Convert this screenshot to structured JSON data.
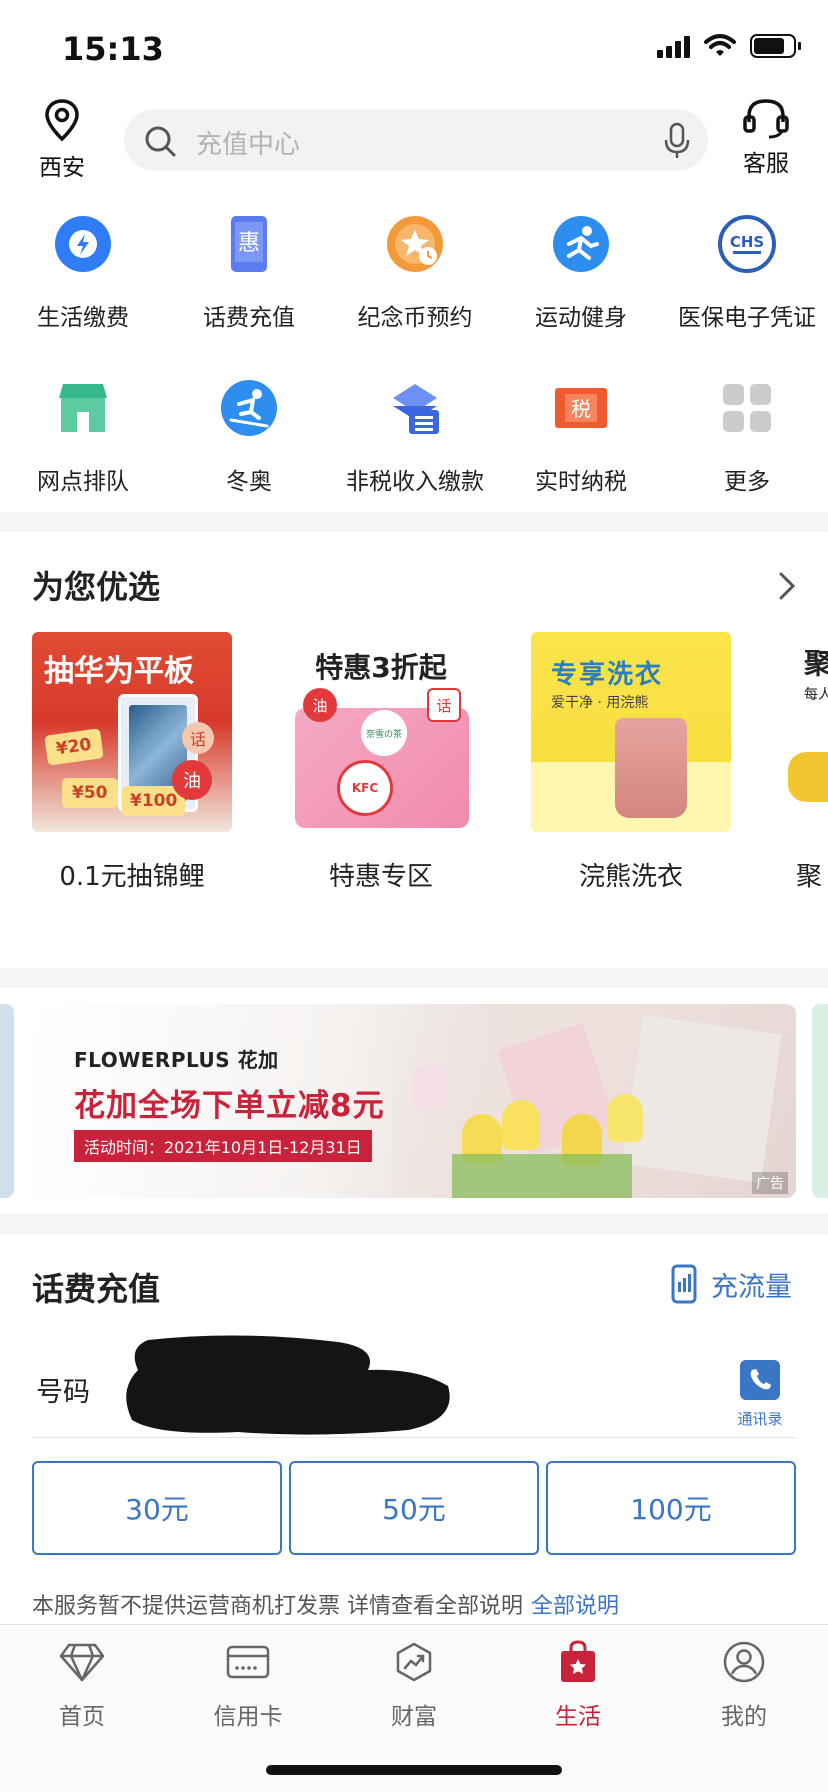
{
  "status_bar": {
    "time": "15:13"
  },
  "header": {
    "location": "西安",
    "search_placeholder": "充值中心",
    "service_label": "客服"
  },
  "grid": [
    {
      "label": "生活缴费",
      "icon": "lightning-bolt-icon",
      "color": "#2f7cf6"
    },
    {
      "label": "话费充值",
      "icon": "discount-tablet-icon",
      "color": "#5b7cf0"
    },
    {
      "label": "纪念币预约",
      "icon": "star-coin-clock-icon",
      "color": "#f29a38"
    },
    {
      "label": "运动健身",
      "icon": "sport-runner-icon",
      "color": "#2e8ef0"
    },
    {
      "label": "医保电子凭证",
      "icon": "chs-medical-insurance-icon",
      "color": "#2e5fb8"
    },
    {
      "label": "网点排队",
      "icon": "branch-store-icon",
      "color": "#35b98a"
    },
    {
      "label": "冬奥",
      "icon": "skier-icon",
      "color": "#2e8ef0"
    },
    {
      "label": "非税收入缴款",
      "icon": "layers-list-icon",
      "color": "#3b66e0"
    },
    {
      "label": "实时纳税",
      "icon": "tax-card-icon",
      "color": "#ef5a2f"
    },
    {
      "label": "更多",
      "icon": "more-grid-icon",
      "color": "#cccccc"
    }
  ],
  "recommend": {
    "title": "为您优选",
    "items": [
      {
        "label": "0.1元抽锦鲤",
        "img_title": "抽华为平板",
        "coupon1": "¥20",
        "coupon2": "¥50",
        "coupon3": "¥100",
        "tag1": "话",
        "tag2": "油"
      },
      {
        "label": "特惠专区",
        "img_title": "特惠3折起",
        "tag1": "油",
        "tag2": "话",
        "tag3": "奈雪の茶",
        "tag4": "KFC"
      },
      {
        "label": "浣熊洗衣",
        "img_title": "专享洗衣",
        "img_sub": "爱干净 · 用浣熊"
      },
      {
        "label": "聚",
        "img_title": "聚",
        "img_sub": "每人"
      }
    ]
  },
  "banner": {
    "brand": "FLOWERPLUS 花加",
    "title": "花加全场下单立减8元",
    "date": "活动时间：2021年10月1日-12月31日",
    "ad": "广告"
  },
  "topup": {
    "title": "话费充值",
    "flow_label": "充流量",
    "phone_label": "号码",
    "contacts_label": "通讯录",
    "amounts": [
      "30元",
      "50元",
      "100元"
    ],
    "note": "本服务暂不提供运营商机打发票 详情查看全部说明",
    "note_link": "全部说明"
  },
  "tabbar": {
    "active": "生活",
    "tabs": [
      {
        "label": "首页",
        "icon": "diamond-icon"
      },
      {
        "label": "信用卡",
        "icon": "credit-card-icon"
      },
      {
        "label": "财富",
        "icon": "wealth-chart-icon"
      },
      {
        "label": "生活",
        "icon": "shopping-bag-icon"
      },
      {
        "label": "我的",
        "icon": "profile-icon"
      }
    ]
  },
  "colors": {
    "accent_blue": "#3a76c5",
    "accent_red": "#c8233a"
  }
}
